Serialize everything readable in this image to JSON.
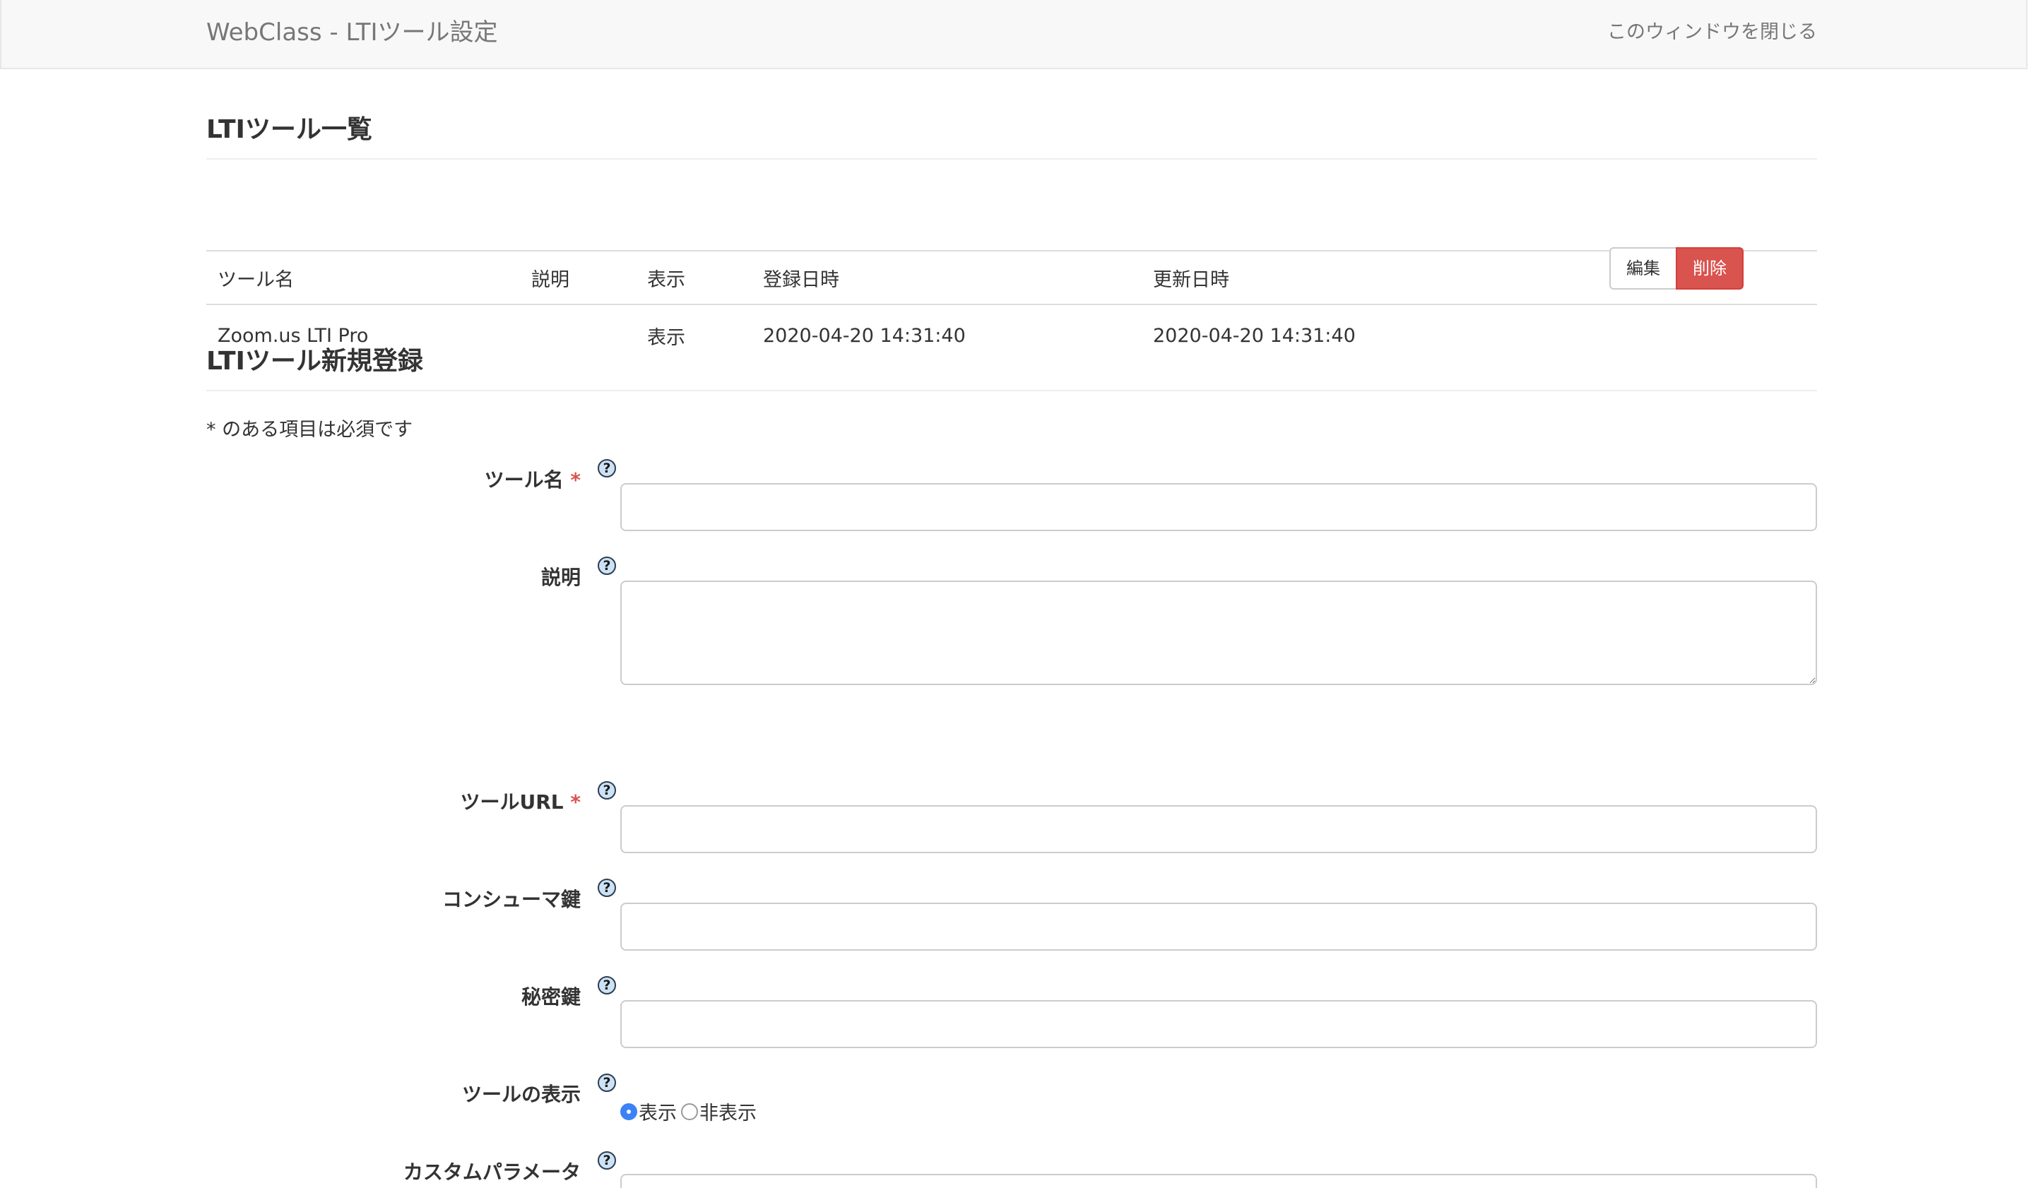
{
  "navbar": {
    "brand": "WebClass - LTIツール設定",
    "close_label": "このウィンドウを閉じる"
  },
  "list_section": {
    "title": "LTIツール一覧",
    "headers": [
      "ツール名",
      "説明",
      "表示",
      "登録日時",
      "更新日時"
    ],
    "rows": [
      {
        "name": "Zoom.us LTI Pro",
        "description": "",
        "display": "表示",
        "created": "2020-04-20 14:31:40",
        "updated": "2020-04-20 14:31:40",
        "edit_label": "編集",
        "delete_label": "削除"
      }
    ]
  },
  "form_section": {
    "title": "LTIツール新規登録",
    "required_note": "* のある項目は必須です",
    "help_glyph": "?",
    "required_mark": "*",
    "fields": {
      "tool_name": {
        "label": "ツール名",
        "value": ""
      },
      "description": {
        "label": "説明",
        "value": ""
      },
      "tool_url": {
        "label": "ツールURL",
        "value": ""
      },
      "consumer_key": {
        "label": "コンシューマ鍵",
        "value": ""
      },
      "secret_key": {
        "label": "秘密鍵",
        "value": ""
      },
      "visibility": {
        "label": "ツールの表示",
        "option_show": "表示",
        "option_hide": "非表示",
        "selected": "表示"
      },
      "custom_params": {
        "label": "カスタムパラメータ"
      }
    }
  },
  "colors": {
    "danger": "#d9534f",
    "navbar_bg": "#f8f8f8",
    "radio_selected": "#3b82f6"
  }
}
